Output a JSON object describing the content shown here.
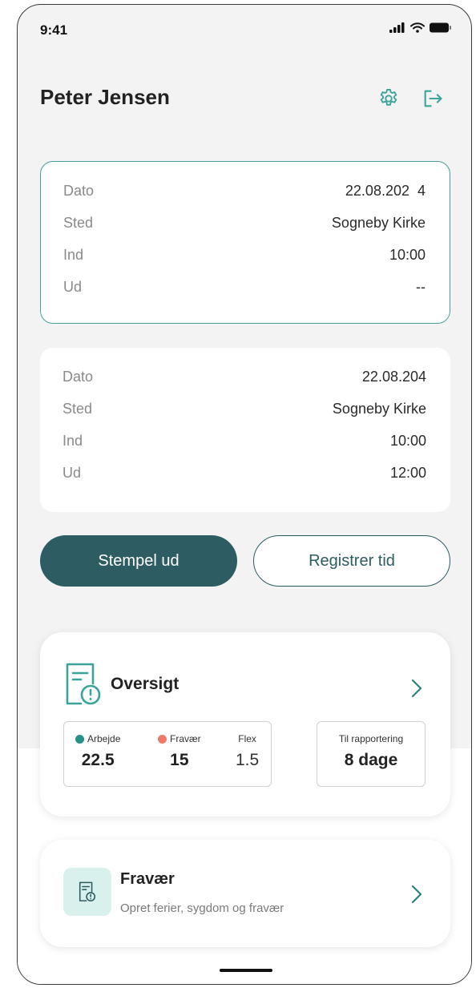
{
  "status_bar": {
    "time": "9:41"
  },
  "header": {
    "title": "Peter Jensen"
  },
  "records": [
    {
      "rows": [
        {
          "label": "Dato",
          "value": "22.08.202  4"
        },
        {
          "label": "Sted",
          "value": "Sogneby Kirke"
        },
        {
          "label": "Ind",
          "value": "10:00"
        },
        {
          "label": "Ud",
          "value": "--"
        }
      ]
    },
    {
      "rows": [
        {
          "label": "Dato",
          "value": "22.08.204"
        },
        {
          "label": "Sted",
          "value": "Sogneby Kirke"
        },
        {
          "label": "Ind",
          "value": "10:00"
        },
        {
          "label": "Ud",
          "value": "12:00"
        }
      ]
    }
  ],
  "actions": {
    "stamp_out": "Stempel ud",
    "register_time": "Registrer tid"
  },
  "overview": {
    "title": "Oversigt",
    "stats": {
      "work_label": "Arbejde",
      "work_value": "22.5",
      "absence_label": "Fravær",
      "absence_value": "15",
      "flex_label": "Flex",
      "flex_value": "1.5"
    },
    "report_label": "Til rapportering",
    "report_value": "8 dage"
  },
  "absence": {
    "title": "Fravær",
    "subtitle": "Opret ferier, sygdom og fravær"
  },
  "colors": {
    "accent": "#2d5c63",
    "teal_icon": "#3aa39a",
    "work_dot": "#2a8f88",
    "absence_dot": "#f07a6a",
    "active_border": "#4a9f9a"
  },
  "icons": {
    "settings": "gear-icon",
    "logout": "logout-icon",
    "overview": "document-alert-icon",
    "absence": "document-alert-icon",
    "chevron": "chevron-right-icon"
  }
}
